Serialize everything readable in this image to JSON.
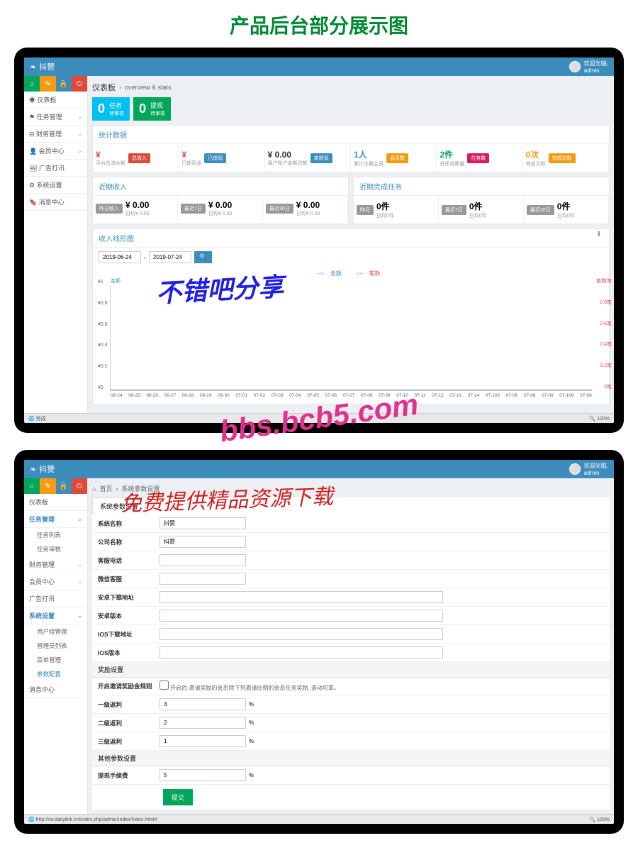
{
  "page_heading": "产品后台部分展示图",
  "watermarks": {
    "w1": "不错吧分享",
    "w2": "bbs.bcb5.com",
    "w3": "免费提供精品资源下载"
  },
  "screen1": {
    "brand": "抖赞",
    "user": {
      "welcome": "欢迎光临,",
      "name": "admin"
    },
    "nav": [
      {
        "label": "仪表板",
        "icon": "dashboard"
      },
      {
        "label": "任务管理",
        "icon": "flag",
        "expand": true
      },
      {
        "label": "财务管理",
        "icon": "money",
        "expand": true
      },
      {
        "label": "会员中心",
        "icon": "user",
        "expand": true
      },
      {
        "label": "广告打讯",
        "icon": "image"
      },
      {
        "label": "系统设置",
        "icon": "gear"
      },
      {
        "label": "消息中心",
        "icon": "bookmark"
      }
    ],
    "breadcrumb": {
      "title": "仪表板",
      "path": "overview & stats"
    },
    "topstats": [
      {
        "count": "0",
        "title": "任务",
        "sub": "待审核"
      },
      {
        "count": "0",
        "title": "提现",
        "sub": "待审核"
      }
    ],
    "section_stats": "统计数据",
    "metrics": [
      {
        "val": "¥",
        "lbl": "平台总流水额",
        "tag": "总收入",
        "tagcolor": "#dd4b39",
        "color": "#dd4b39"
      },
      {
        "val": "¥",
        "lbl": "已提现金",
        "tag": "已提现",
        "tagcolor": "#3c8dbc",
        "color": "#dd4b39"
      },
      {
        "val": "¥ 0.00",
        "lbl": "用户账户金额总额",
        "tag": "未提现",
        "tagcolor": "#3c8dbc",
        "color": "#333"
      },
      {
        "val": "1人",
        "lbl": "累计注册会员",
        "tag": "会员数",
        "tagcolor": "#f39c12",
        "color": "#3c8dbc"
      },
      {
        "val": "2件",
        "lbl": "总任务数量",
        "tag": "任务数",
        "tagcolor": "#d81b60",
        "color": "#00a65a"
      },
      {
        "val": "0次",
        "lbl": "完成次数",
        "tag": "完成次数",
        "tagcolor": "#f39c12",
        "color": "#f39c12"
      }
    ],
    "recent_income": "近期收入",
    "recent_tasks": "近期完成任务",
    "income_items": [
      {
        "tag": "昨日收入",
        "val": "¥ 0.00",
        "sub": "日均¥ 0.00"
      },
      {
        "tag": "最近7日",
        "val": "¥ 0.00",
        "sub": "日均¥ 0.00"
      },
      {
        "tag": "最近30日",
        "val": "¥ 0.00",
        "sub": "日均¥ 0.00"
      }
    ],
    "task_items": [
      {
        "tag": "昨日",
        "val": "0件",
        "sub": "日均0件"
      },
      {
        "tag": "最近7日",
        "val": "0件",
        "sub": "日均0件"
      },
      {
        "tag": "最近30日",
        "val": "0件",
        "sub": "日均0件"
      }
    ],
    "chart_section": "收入线形图",
    "date_from": "2019-06-24",
    "date_to": "2019-07-24",
    "legend": {
      "a": "金额",
      "b": "笔数"
    },
    "status": "完成",
    "zoom": "100%"
  },
  "chart_data": {
    "type": "line",
    "title": "收入线形图",
    "xlabel": "",
    "ylabel_left": "金额",
    "ylabel_right": "笔数",
    "ylim_left": [
      0,
      1
    ],
    "ylim_right": [
      0,
      1
    ],
    "y_ticks_left": [
      "¥0",
      "¥0.2",
      "¥0.4",
      "¥0.6",
      "¥0.8",
      "¥1"
    ],
    "y_ticks_right": [
      "0笔",
      "0.2笔",
      "0.4笔",
      "0.6笔",
      "0.8笔",
      "1笔"
    ],
    "categories": [
      "06-24",
      "06-25",
      "06-26",
      "06-27",
      "06-28",
      "06-29",
      "06-30",
      "07-01",
      "07-02",
      "07-03",
      "07-04",
      "07-05",
      "07-06",
      "07-07",
      "07-08",
      "07-09",
      "07-10",
      "07-11",
      "07-12",
      "07-13",
      "07-14",
      "07-103",
      "07-06",
      "07-08",
      "07-08",
      "07-108",
      "07-08"
    ],
    "series": [
      {
        "name": "金额",
        "values": [
          0,
          0,
          0,
          0,
          0,
          0,
          0,
          0,
          0,
          0,
          0,
          0,
          0,
          0,
          0,
          0,
          0,
          0,
          0,
          0,
          0,
          0,
          0,
          0,
          0,
          0,
          0
        ]
      },
      {
        "name": "笔数",
        "values": [
          0,
          0,
          0,
          0,
          0,
          0,
          0,
          0,
          0,
          0,
          0,
          0,
          0,
          0,
          0,
          0,
          0,
          0,
          0,
          0,
          0,
          0,
          0,
          0,
          0,
          0,
          0
        ]
      }
    ]
  },
  "screen2": {
    "brand": "抖赞",
    "user": {
      "welcome": "欢迎光临,",
      "name": "admin"
    },
    "breadcrumb": {
      "home": "首页",
      "path": "系统参数设置"
    },
    "tab": "系统参数设置",
    "nav": [
      {
        "label": "仪表板"
      },
      {
        "label": "任务管理",
        "active": true,
        "subs": [
          "任务列表",
          "任务审核"
        ]
      },
      {
        "label": "财务管理",
        "expand": true
      },
      {
        "label": "会员中心",
        "expand": true
      },
      {
        "label": "广告打讯"
      },
      {
        "label": "系统设置",
        "active": true,
        "subs": [
          "用户组管理",
          "管理员列表",
          "菜单管理",
          "参数配置"
        ]
      },
      {
        "label": "消息中心"
      }
    ],
    "fields": {
      "sys_name": {
        "label": "系统名称",
        "value": "抖赞"
      },
      "company": {
        "label": "公司名称",
        "value": "抖赞"
      },
      "phone": {
        "label": "客服电话",
        "value": ""
      },
      "wechat": {
        "label": "微信客服",
        "value": ""
      },
      "android_url": {
        "label": "安卓下载地址",
        "value": ""
      },
      "android_ver": {
        "label": "安卓版本",
        "value": ""
      },
      "ios_url": {
        "label": "IOS下载地址",
        "value": ""
      },
      "ios_ver": {
        "label": "IOS版本",
        "value": ""
      }
    },
    "reward_section": "奖励设置",
    "reward_rule": {
      "label": "开启邀请奖励金规则",
      "text": "开启后,邀请奖励的会员除下列邀请比例的会员任务奖励, 滚动可拿。"
    },
    "levels": [
      {
        "label": "一级返利",
        "value": "3"
      },
      {
        "label": "二级返利",
        "value": "2"
      },
      {
        "label": "三级返利",
        "value": "1"
      }
    ],
    "other_section": "其他参数设置",
    "withdraw": {
      "label": "提现手续费",
      "value": "5"
    },
    "submit": "提交",
    "url": "http://rw.dailylink.cn/index.php/admin/Index/index.html#",
    "zoom": "100%"
  }
}
